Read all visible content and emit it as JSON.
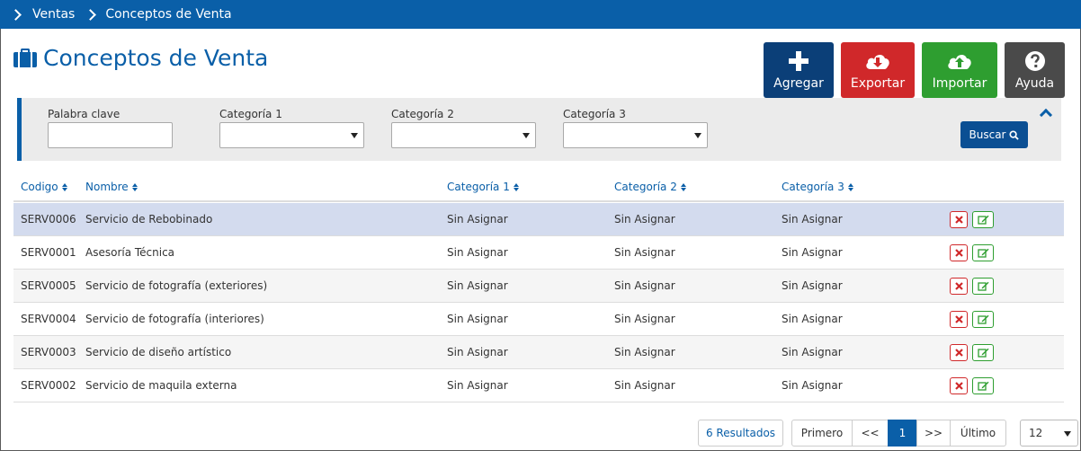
{
  "breadcrumb": [
    "Ventas",
    "Conceptos de Venta"
  ],
  "page": {
    "title": "Conceptos de Venta"
  },
  "actions": {
    "add": "Agregar",
    "export": "Exportar",
    "import": "Importar",
    "help": "Ayuda"
  },
  "filters": {
    "keyword_label": "Palabra clave",
    "keyword_value": "",
    "cat1_label": "Categoría 1",
    "cat1_value": "",
    "cat2_label": "Categoría 2",
    "cat2_value": "",
    "cat3_label": "Categoría 3",
    "cat3_value": "",
    "search_button": "Buscar"
  },
  "table": {
    "columns": [
      "Codigo",
      "Nombre",
      "Categoría 1",
      "Categoría 2",
      "Categoría 3"
    ],
    "rows": [
      {
        "code": "SERV0006",
        "name": "Servicio de Rebobinado",
        "cat1": "Sin Asignar",
        "cat2": "Sin Asignar",
        "cat3": "Sin Asignar",
        "selected": true
      },
      {
        "code": "SERV0001",
        "name": "Asesoría Técnica",
        "cat1": "Sin Asignar",
        "cat2": "Sin Asignar",
        "cat3": "Sin Asignar"
      },
      {
        "code": "SERV0005",
        "name": "Servicio de fotografía (exteriores)",
        "cat1": "Sin Asignar",
        "cat2": "Sin Asignar",
        "cat3": "Sin Asignar"
      },
      {
        "code": "SERV0004",
        "name": "Servicio de fotografía (interiores)",
        "cat1": "Sin Asignar",
        "cat2": "Sin Asignar",
        "cat3": "Sin Asignar"
      },
      {
        "code": "SERV0003",
        "name": "Servicio de diseño artístico",
        "cat1": "Sin Asignar",
        "cat2": "Sin Asignar",
        "cat3": "Sin Asignar"
      },
      {
        "code": "SERV0002",
        "name": "Servicio de maquila externa",
        "cat1": "Sin Asignar",
        "cat2": "Sin Asignar",
        "cat3": "Sin Asignar"
      }
    ]
  },
  "pagination": {
    "results": "6 Resultados",
    "first": "Primero",
    "prev": "<<",
    "current": "1",
    "next": ">>",
    "last": "Último",
    "page_size": "12"
  },
  "colors": {
    "brand": "#0a5fa8",
    "add": "#0b3f78",
    "export": "#d0282a",
    "import": "#2e9e30",
    "help": "#4a4a4a",
    "selected_row": "#d3dbee"
  },
  "icons": [
    "chevron-right-icon",
    "briefcase-icon",
    "plus-icon",
    "cloud-download-icon",
    "cloud-upload-icon",
    "question-circle-icon",
    "search-icon",
    "chevron-up-icon",
    "sort-icon",
    "delete-icon",
    "edit-icon",
    "dropdown-arrow-icon"
  ]
}
